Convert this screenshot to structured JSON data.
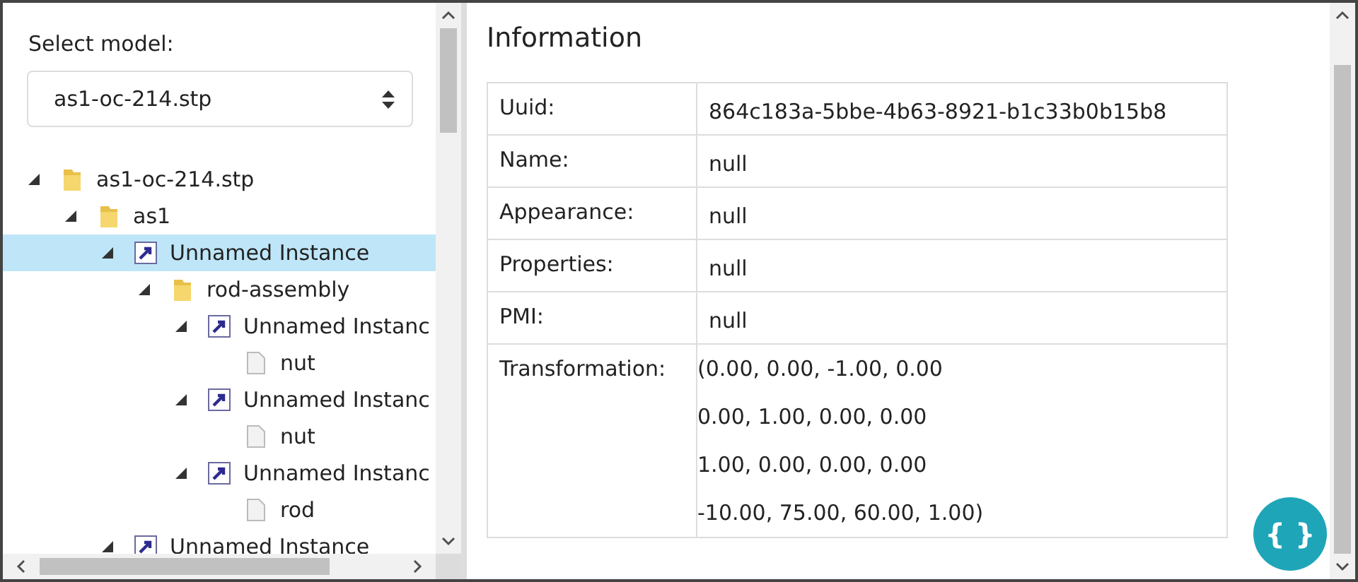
{
  "sidebar": {
    "select_label": "Select model:",
    "model_select": {
      "value": "as1-oc-214.stp"
    },
    "tree": [
      {
        "kind": "folder",
        "label": "as1-oc-214.stp",
        "expanded": true,
        "selected": false,
        "children": [
          {
            "kind": "folder",
            "label": "as1",
            "expanded": true,
            "selected": false,
            "children": [
              {
                "kind": "instance",
                "label": "Unnamed Instance",
                "expanded": true,
                "selected": true,
                "children": [
                  {
                    "kind": "folder",
                    "label": "rod-assembly",
                    "expanded": true,
                    "selected": false,
                    "children": [
                      {
                        "kind": "instance",
                        "label": "Unnamed Instanc",
                        "expanded": true,
                        "selected": false,
                        "children": [
                          {
                            "kind": "file",
                            "label": "nut",
                            "selected": false
                          }
                        ]
                      },
                      {
                        "kind": "instance",
                        "label": "Unnamed Instanc",
                        "expanded": true,
                        "selected": false,
                        "children": [
                          {
                            "kind": "file",
                            "label": "nut",
                            "selected": false
                          }
                        ]
                      },
                      {
                        "kind": "instance",
                        "label": "Unnamed Instanc",
                        "expanded": true,
                        "selected": false,
                        "children": [
                          {
                            "kind": "file",
                            "label": "rod",
                            "selected": false
                          }
                        ]
                      }
                    ]
                  }
                ]
              },
              {
                "kind": "instance",
                "label": "Unnamed Instance",
                "expanded": true,
                "selected": false
              }
            ]
          }
        ]
      }
    ]
  },
  "info": {
    "title": "Information",
    "rows": [
      {
        "label": "Uuid:",
        "values": [
          "864c183a-5bbe-4b63-8921-b1c33b0b15b8"
        ]
      },
      {
        "label": "Name:",
        "values": [
          "null"
        ]
      },
      {
        "label": "Appearance:",
        "values": [
          "null"
        ]
      },
      {
        "label": "Properties:",
        "values": [
          "null"
        ]
      },
      {
        "label": "PMI:",
        "values": [
          "null"
        ]
      },
      {
        "label": "Transformation:",
        "values": [
          "(0.00, 0.00, -1.00, 0.00",
          "0.00, 1.00, 0.00, 0.00",
          "1.00, 0.00, 0.00, 0.00",
          "-10.00, 75.00, 60.00, 1.00)"
        ]
      }
    ]
  },
  "fab": {
    "label": "{ }"
  }
}
